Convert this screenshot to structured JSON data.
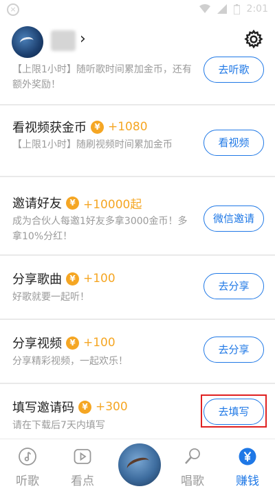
{
  "statusbar": {
    "time": "2:01"
  },
  "tasks": [
    {
      "title": "",
      "reward": "",
      "desc": "【上限1小时】随听歌时间累加金币，还有额外奖励！",
      "button": "去听歌"
    },
    {
      "title": "看视频获金币",
      "reward": "+1080",
      "desc": "【上限1小时】随刷视频时间累加金币",
      "button": "看视频"
    },
    {
      "title": "邀请好友",
      "reward": "+10000起",
      "desc": "成为合伙人每邀1好友多拿3000金币！多拿10%分红！",
      "button": "微信邀请"
    },
    {
      "title": "分享歌曲",
      "reward": "+100",
      "desc": "好歌就要一起听！",
      "button": "去分享"
    },
    {
      "title": "分享视频",
      "reward": "+100",
      "desc": "分享精彩视频，一起欢乐！",
      "button": "去分享"
    },
    {
      "title": "填写邀请码",
      "reward": "+300",
      "desc": "请在下载后7天内填写",
      "button": "去填写"
    }
  ],
  "coin_symbol": "¥",
  "tabbar": [
    {
      "label": "听歌",
      "icon": "music-note-icon",
      "active": false
    },
    {
      "label": "看点",
      "icon": "play-video-icon",
      "active": false
    },
    {
      "label": "唱歌",
      "icon": "microphone-icon",
      "active": false
    },
    {
      "label": "赚钱",
      "icon": "yuan-coin-icon",
      "active": true
    }
  ],
  "colors": {
    "accent": "#1f78e6",
    "coin": "#f5a623",
    "highlight": "#e02020"
  }
}
